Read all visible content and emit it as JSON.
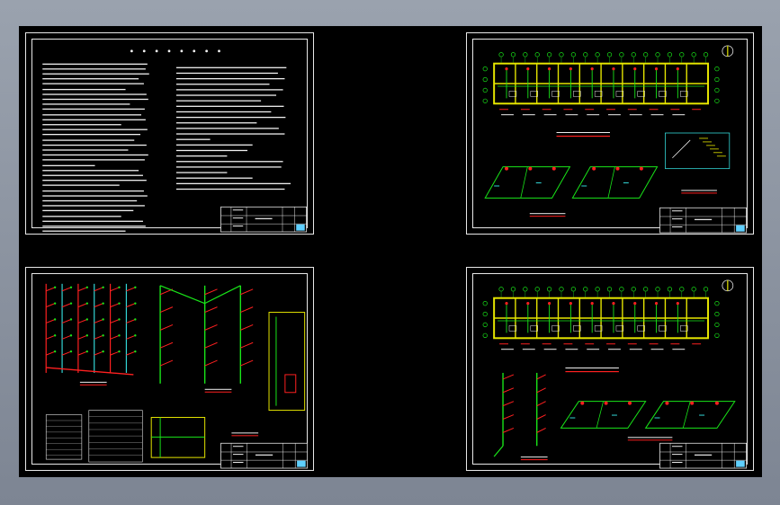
{
  "app": {
    "background": "#000000",
    "canvas_frame": "#9aa2ae"
  },
  "colors": {
    "frame": "#e8e8e8",
    "wall": "#e6e600",
    "pipe_green": "#19e619",
    "pipe_red": "#ff2020",
    "text_white": "#f0f0f0",
    "cyan": "#33d6d6",
    "title_cyan": "#5fd0ff"
  },
  "sheets": [
    {
      "id": "design-notes",
      "kind": "notes"
    },
    {
      "id": "floor-plan-1",
      "kind": "plan"
    },
    {
      "id": "riser-diagrams",
      "kind": "riser"
    },
    {
      "id": "floor-plan-2",
      "kind": "plan"
    }
  ]
}
